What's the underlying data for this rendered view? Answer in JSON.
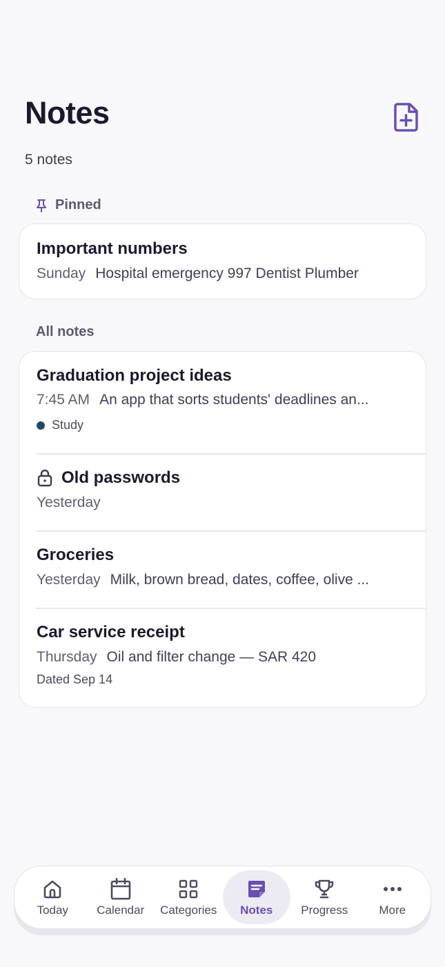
{
  "header": {
    "title": "Notes",
    "note_count": "5 notes"
  },
  "pinned": {
    "label": "Pinned",
    "items": [
      {
        "title": "Important numbers",
        "when": "Sunday",
        "preview": "Hospital emergency 997 Dentist Plumber"
      }
    ]
  },
  "all_notes": {
    "label": "All notes",
    "items": [
      {
        "title": "Graduation project ideas",
        "when": "7:45 AM",
        "preview": "An app that sorts students' deadlines an...",
        "tag": "Study"
      },
      {
        "title": "Old passwords",
        "when": "Yesterday",
        "locked": true
      },
      {
        "title": "Groceries",
        "when": "Yesterday",
        "preview": "Milk, brown bread, dates, coffee, olive ..."
      },
      {
        "title": "Car service receipt",
        "when": "Thursday",
        "preview": "Oil and filter change — SAR 420",
        "extra": "Dated Sep 14"
      }
    ]
  },
  "bottom_nav": {
    "items": [
      {
        "label": "Today",
        "icon": "home-icon"
      },
      {
        "label": "Calendar",
        "icon": "calendar-icon"
      },
      {
        "label": "Categories",
        "icon": "grid-icon"
      },
      {
        "label": "Notes",
        "icon": "note-icon",
        "active": true
      },
      {
        "label": "Progress",
        "icon": "trophy-icon"
      },
      {
        "label": "More",
        "icon": "more-icon"
      }
    ]
  },
  "colors": {
    "accent": "#6a4fb0",
    "background": "#f8f8fb",
    "tag_study": "#1f4a68"
  }
}
